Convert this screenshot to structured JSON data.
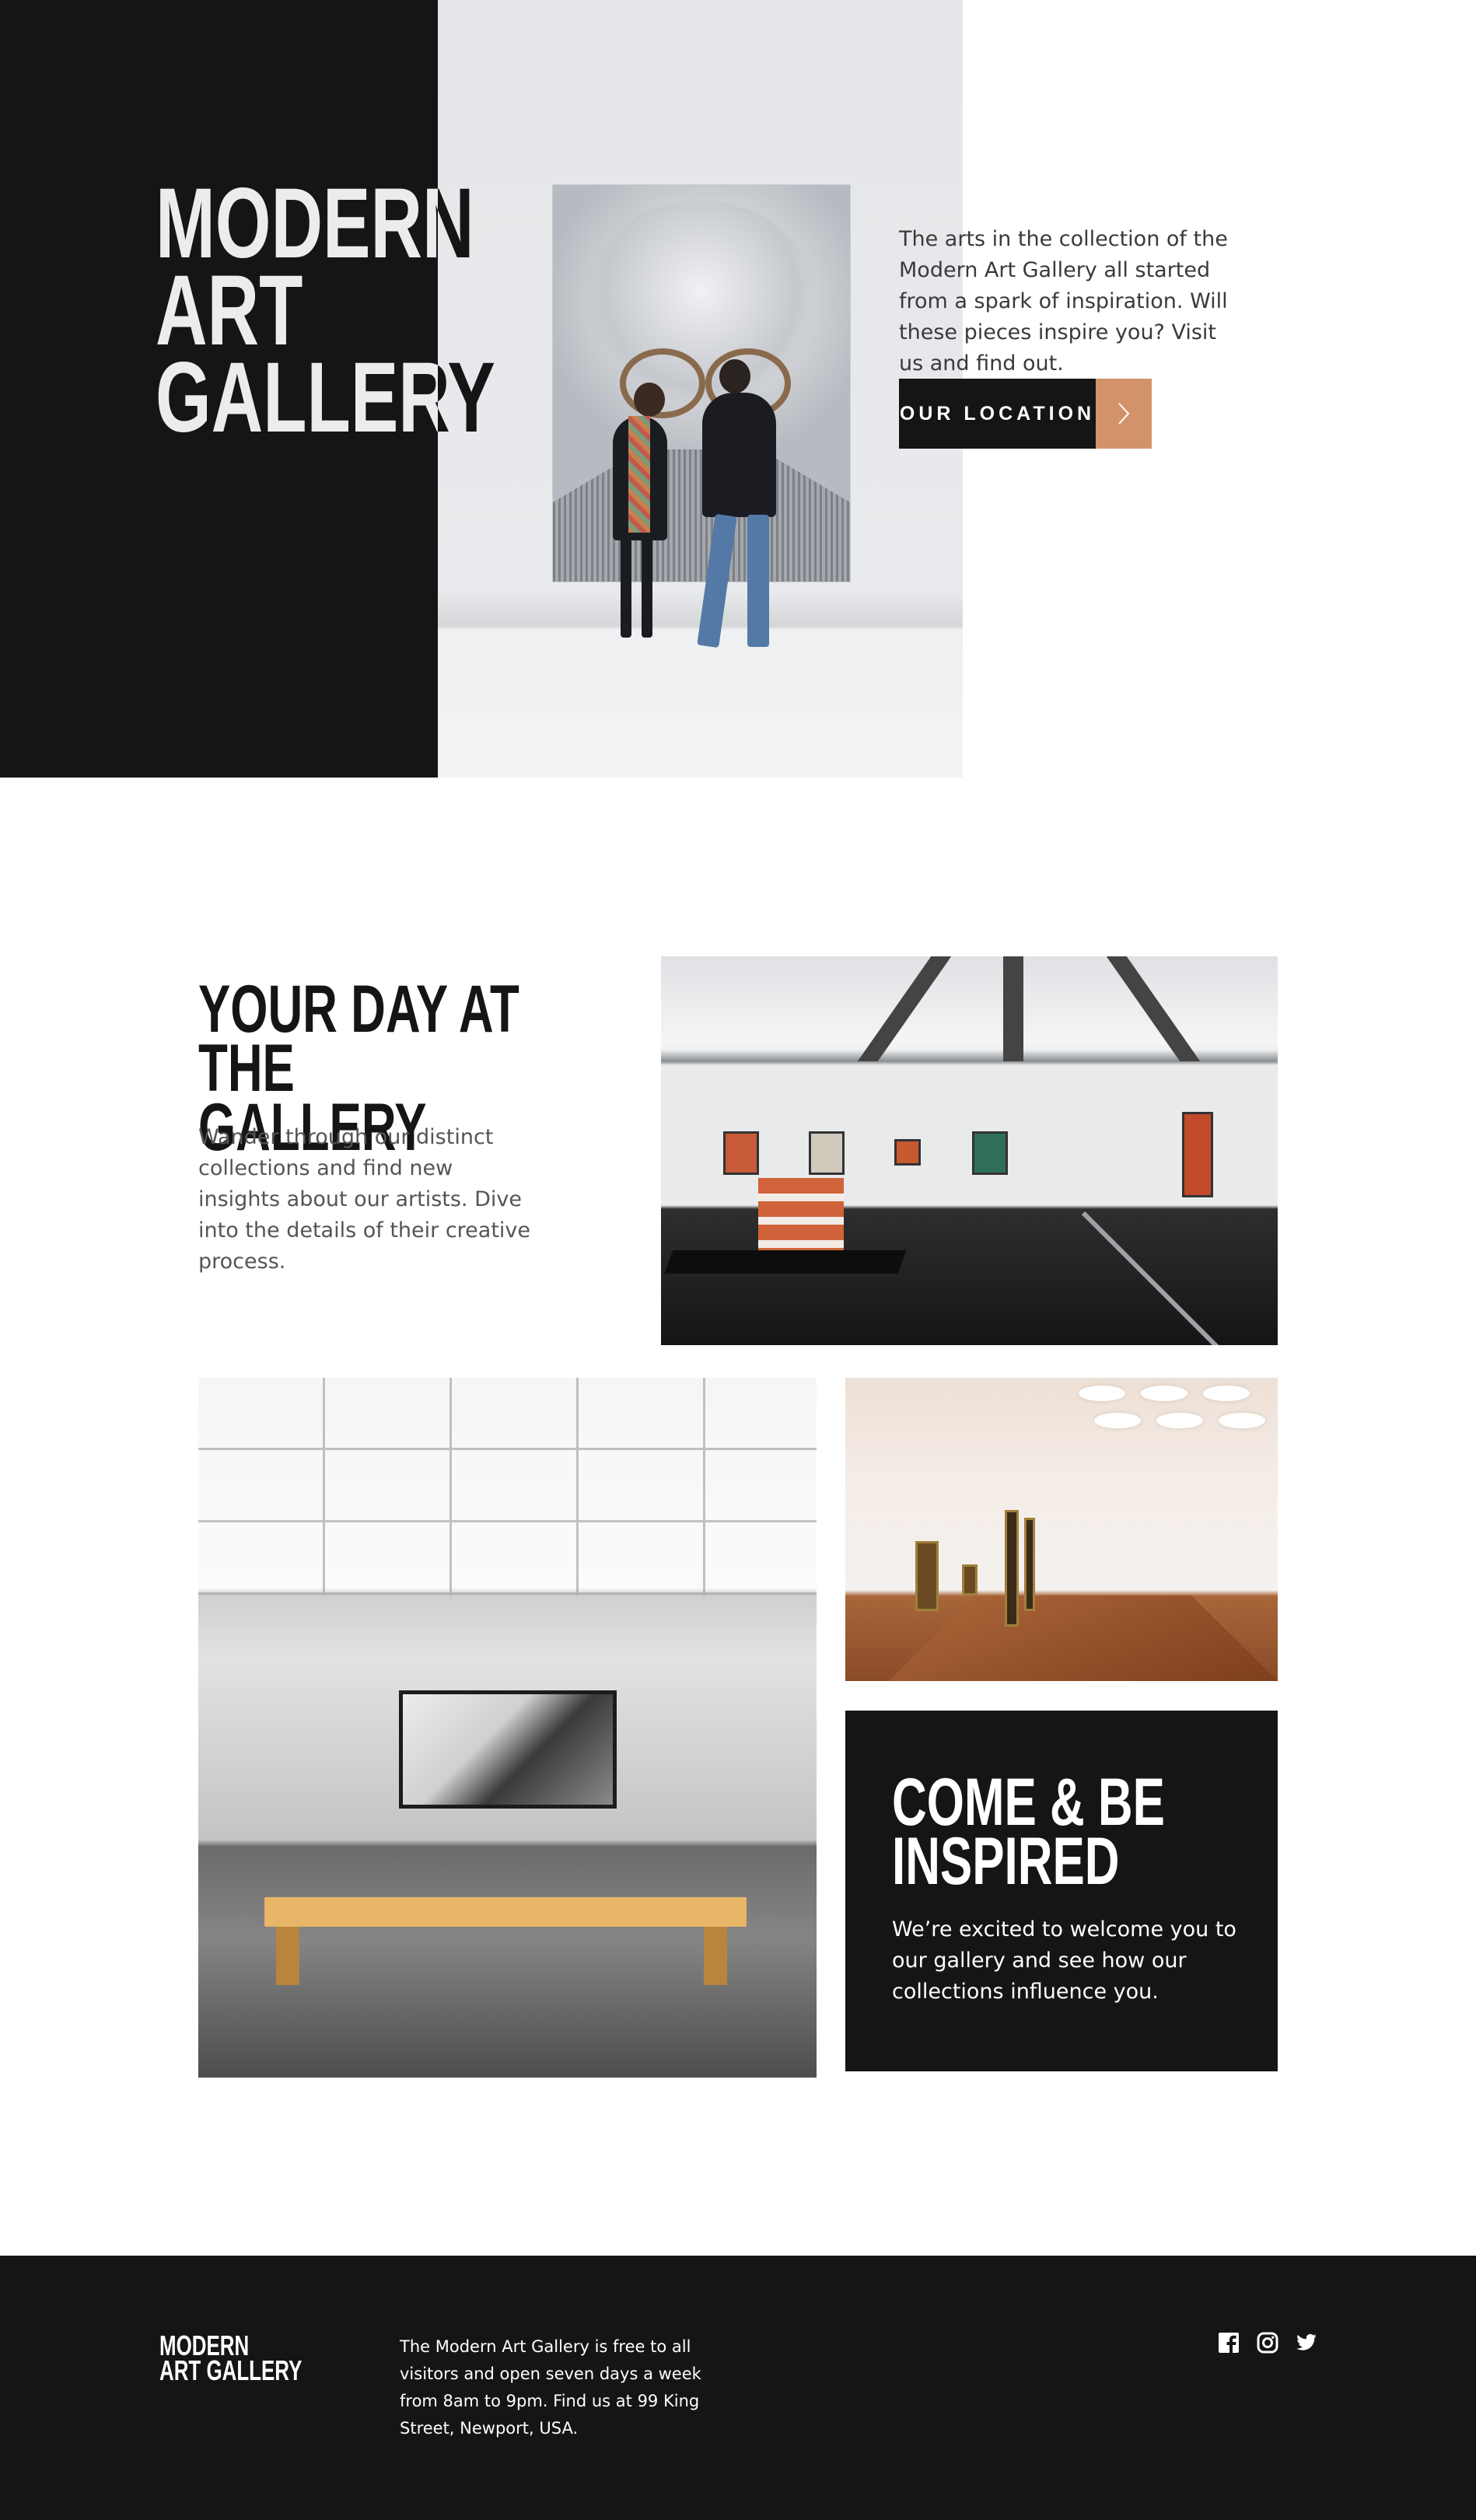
{
  "hero": {
    "title_line1": "Modern",
    "title_line2": "Art Gallery",
    "description": "The arts in the collection of the Modern Art Gallery all started from a spark of inspiration. Will these pieces inspire you? Visit us and find out.",
    "button_label": "OUR LOCATION",
    "button_icon": "chevron-right-icon"
  },
  "day": {
    "title_line1": "Your day at",
    "title_line2": "the gallery",
    "description": "Wander through our distinct collections and find new insights about our artists. Dive into the details of their creative process."
  },
  "inspire": {
    "title_line1": "Come & be",
    "title_line2": "inspired",
    "description": "We’re excited to welcome you to our gallery and see how our collections influence you."
  },
  "footer": {
    "logo_line1": "Modern",
    "logo_line2": "Art Gallery",
    "info": "The Modern Art Gallery is free to all visitors and open seven days a week from 8am to 9pm. Find us at 99 King Street, Newport, USA.",
    "socials": [
      "facebook-icon",
      "instagram-icon",
      "twitter-icon"
    ]
  },
  "colors": {
    "dark": "#151515",
    "accent": "#d3936a",
    "white": "#ffffff"
  }
}
